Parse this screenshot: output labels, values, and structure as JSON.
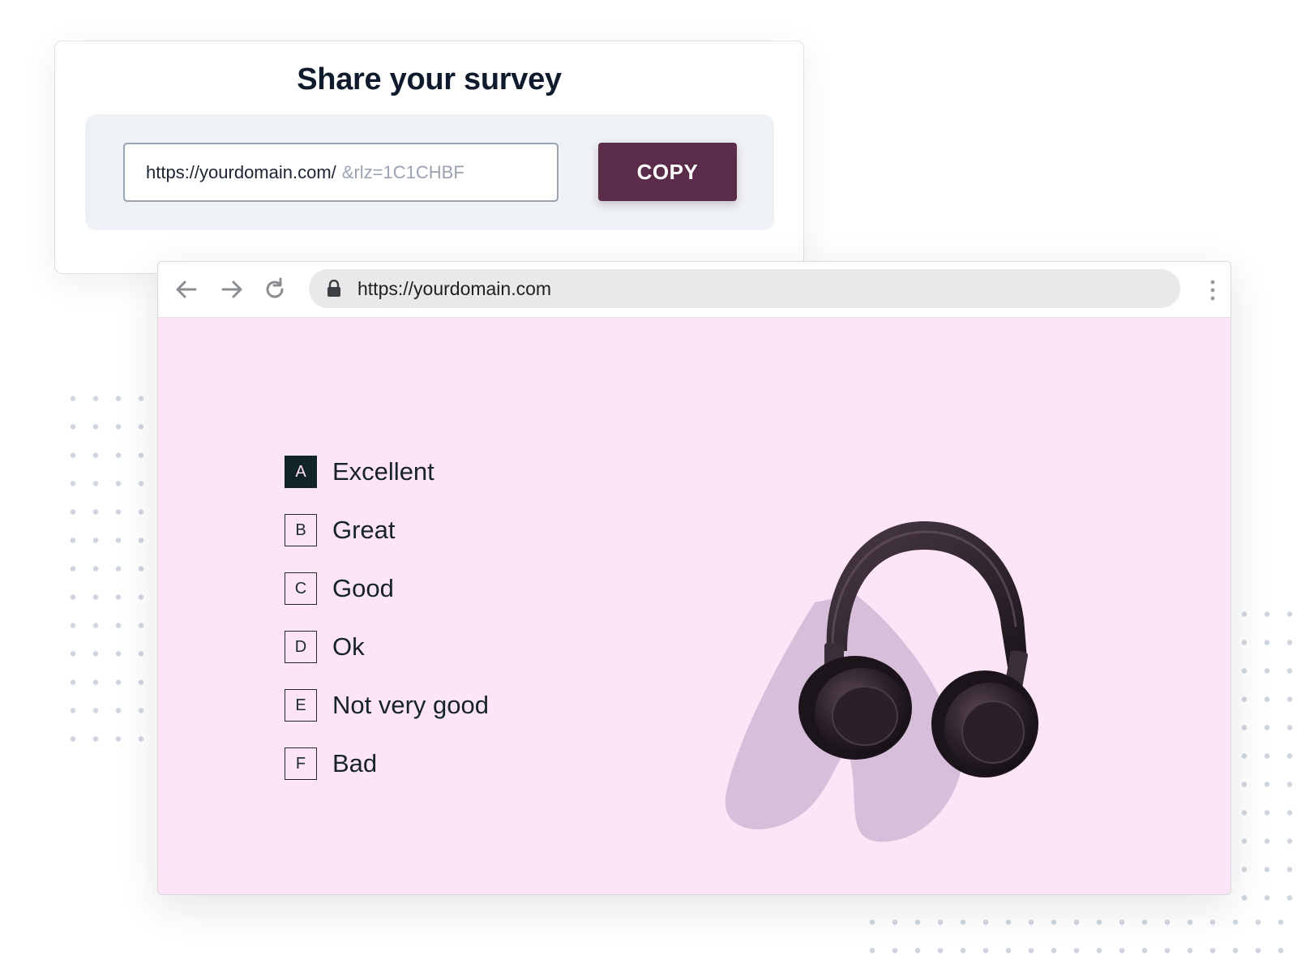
{
  "share": {
    "title": "Share your survey",
    "url_base": "https://yourdomain.com/",
    "url_param": "&rlz=1C1CHBF",
    "copy_label": "COPY"
  },
  "browser": {
    "address": "https://yourdomain.com"
  },
  "survey": {
    "options": [
      {
        "key": "A",
        "label": "Excellent",
        "selected": true
      },
      {
        "key": "B",
        "label": "Great",
        "selected": false
      },
      {
        "key": "C",
        "label": "Good",
        "selected": false
      },
      {
        "key": "D",
        "label": "Ok",
        "selected": false
      },
      {
        "key": "E",
        "label": "Not very good",
        "selected": false
      },
      {
        "key": "F",
        "label": "Bad",
        "selected": false
      }
    ]
  },
  "colors": {
    "brand_button": "#5a2c4a",
    "survey_background": "#fde4f7",
    "selected_key": "#122326"
  },
  "icons": {
    "back": "back-arrow-icon",
    "forward": "forward-arrow-icon",
    "reload": "reload-icon",
    "lock": "lock-icon",
    "menu": "kebab-menu-icon",
    "image": "headphones-image"
  }
}
